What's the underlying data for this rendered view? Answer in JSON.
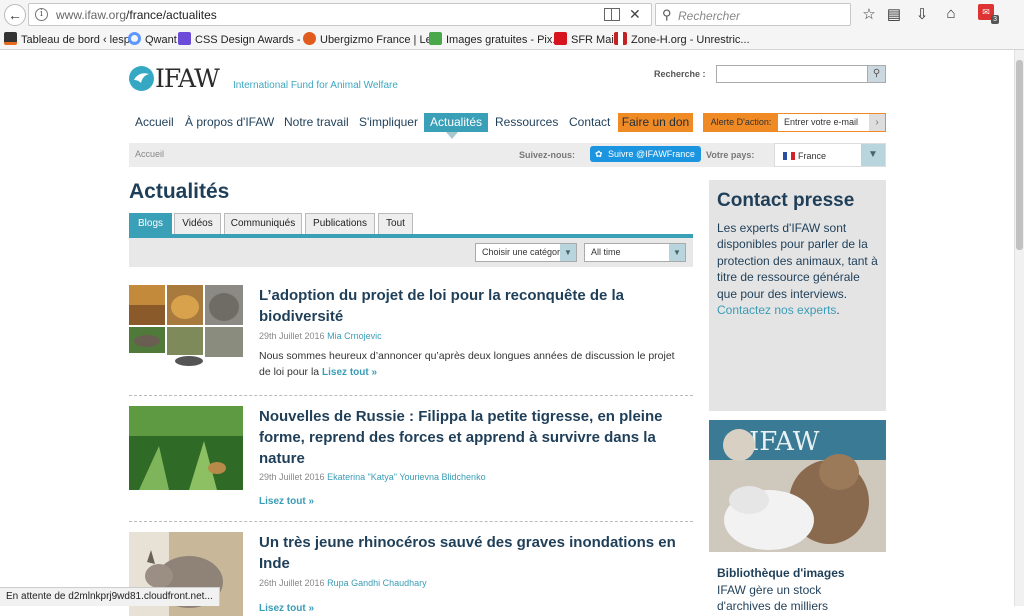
{
  "browser": {
    "url_host": "www.ifaw.org",
    "url_path": "/france/actualites",
    "search_placeholder": "Rechercher",
    "badge_count": "3",
    "bookmarks": [
      {
        "label": "Tableau de bord ‹ lesp...",
        "color": "#333333"
      },
      {
        "label": "Qwant",
        "color": "#5c97ff"
      },
      {
        "label": "CSS Design Awards - ...",
        "color": "#6b4bd8"
      },
      {
        "label": "Ubergizmo France | Le...",
        "color": "#e25b1e"
      },
      {
        "label": "Images gratuites - Pix...",
        "color": "#4aa84a"
      },
      {
        "label": "SFR Mail",
        "color": "#d7141e"
      },
      {
        "label": "Zone-H.org - Unrestric...",
        "color": "#c42222"
      }
    ],
    "status": "En attente de d2mlnkprj9wd81.cloudfront.net..."
  },
  "site": {
    "logo_text": "IFAW",
    "tagline": "International Fund for Animal Welfare",
    "search_label": "Recherche :",
    "nav": [
      {
        "label": "Accueil"
      },
      {
        "label": "À propos d'IFAW"
      },
      {
        "label": "Notre travail"
      },
      {
        "label": "S'impliquer"
      },
      {
        "label": "Actualités",
        "active": true
      },
      {
        "label": "Ressources"
      },
      {
        "label": "Contact"
      }
    ],
    "donate_label": "Faire un don",
    "alert_label": "Alerte D'action:",
    "alert_placeholder": "Entrer votre e-mail",
    "breadcrumb": "Accueil",
    "follow_label": "Suivez-nous:",
    "twitter_label": "Suivre @IFAWFrance",
    "country_label": "Votre pays:",
    "country_value": "France"
  },
  "main": {
    "title": "Actualités",
    "tabs": [
      "Blogs",
      "Vidéos",
      "Communiqués",
      "Publications",
      "Tout"
    ],
    "category_select": "Choisir une catégorie",
    "time_select": "All time",
    "posts": [
      {
        "title": "L’adoption du projet de loi pour la reconquête de la biodiversité",
        "date": "29th Juillet 2016",
        "author": "Mia Crnojevic",
        "excerpt": "Nous sommes heureux d’annoncer qu’après deux longues années de discussion le projet de loi pour la",
        "more": "Lisez tout »"
      },
      {
        "title": "Nouvelles de Russie : Filippa la petite tigresse, en pleine forme, reprend des forces et apprend à survivre dans la nature",
        "date": "29th Juillet 2016",
        "author": "Ekaterina \"Katya\" Yourievna Blidchenko",
        "excerpt": "",
        "more": "Lisez tout »"
      },
      {
        "title": "Un très jeune rhinocéros sauvé des graves inondations en Inde",
        "date": "26th Juillet 2016",
        "author": "Rupa Gandhi Chaudhary",
        "excerpt": "",
        "more": "Lisez tout »"
      }
    ]
  },
  "sidebar": {
    "press_title": "Contact presse",
    "press_text": "Les experts d'IFAW sont disponibles pour parler de la protection des animaux, tant à titre de ressource générale que pour des interviews.",
    "press_link": "Contactez nos experts",
    "library_logo_text": "IFAW",
    "library_title": "Bibliothèque d'images",
    "library_text": "IFAW gère un stock d'archives de milliers"
  },
  "colors": {
    "accent": "#3aa0b8",
    "navy": "#1f3f59",
    "orange": "#f08a24"
  }
}
